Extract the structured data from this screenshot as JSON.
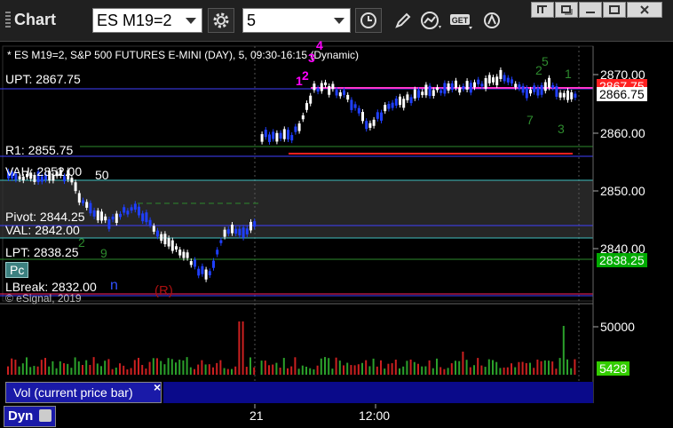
{
  "window": {
    "title": "Chart",
    "symbol": "ES M19=2",
    "interval": "5"
  },
  "chart": {
    "description": "* ES M19=2, S&P 500 FUTURES E-MINI (DAY), 5, 09:30-16:15 (Dynamic)",
    "copyright": "© eSignal, 2019",
    "levels": {
      "upt": "UPT: 2867.75",
      "r1": "R1: 2855.75",
      "vah": "VAH: 2852.00",
      "vah_tail": "50",
      "pivot": "Pivot: 2844.25",
      "val": "VAL: 2842.00",
      "lpt": "LPT: 2838.25",
      "lbreak": "LBreak: 2832.00",
      "lbreak_tail": "n",
      "r_marker": "(R)"
    },
    "pc_label": "Pc",
    "price_axis": [
      "2870.00",
      "2860.00",
      "2850.00",
      "2840.00"
    ],
    "price_boxes": {
      "upper_red": "2867.75",
      "last": "2866.75",
      "lower_green": "2838.25"
    },
    "volume_axis": [
      "50000"
    ],
    "volume_last": "5428",
    "volume_panel_label": "Vol (current price bar)",
    "time_axis": [
      "21",
      "12:00"
    ],
    "bottom_tab": "Dyn",
    "colors": {
      "background": "#000000",
      "up_bar": "#ffffff",
      "down_bar": "#1f3fff",
      "upt_line": "#ff33cc",
      "support_line": "#ff2020",
      "r1_line": "#2e8b2e",
      "lpt_box": "#00aa00",
      "last_box": "#ffffff",
      "volume_up": "#2ba12b",
      "volume_down": "#cc2020",
      "td_count": "#2e8b2e",
      "magenta_count": "#ff00ff"
    }
  }
}
